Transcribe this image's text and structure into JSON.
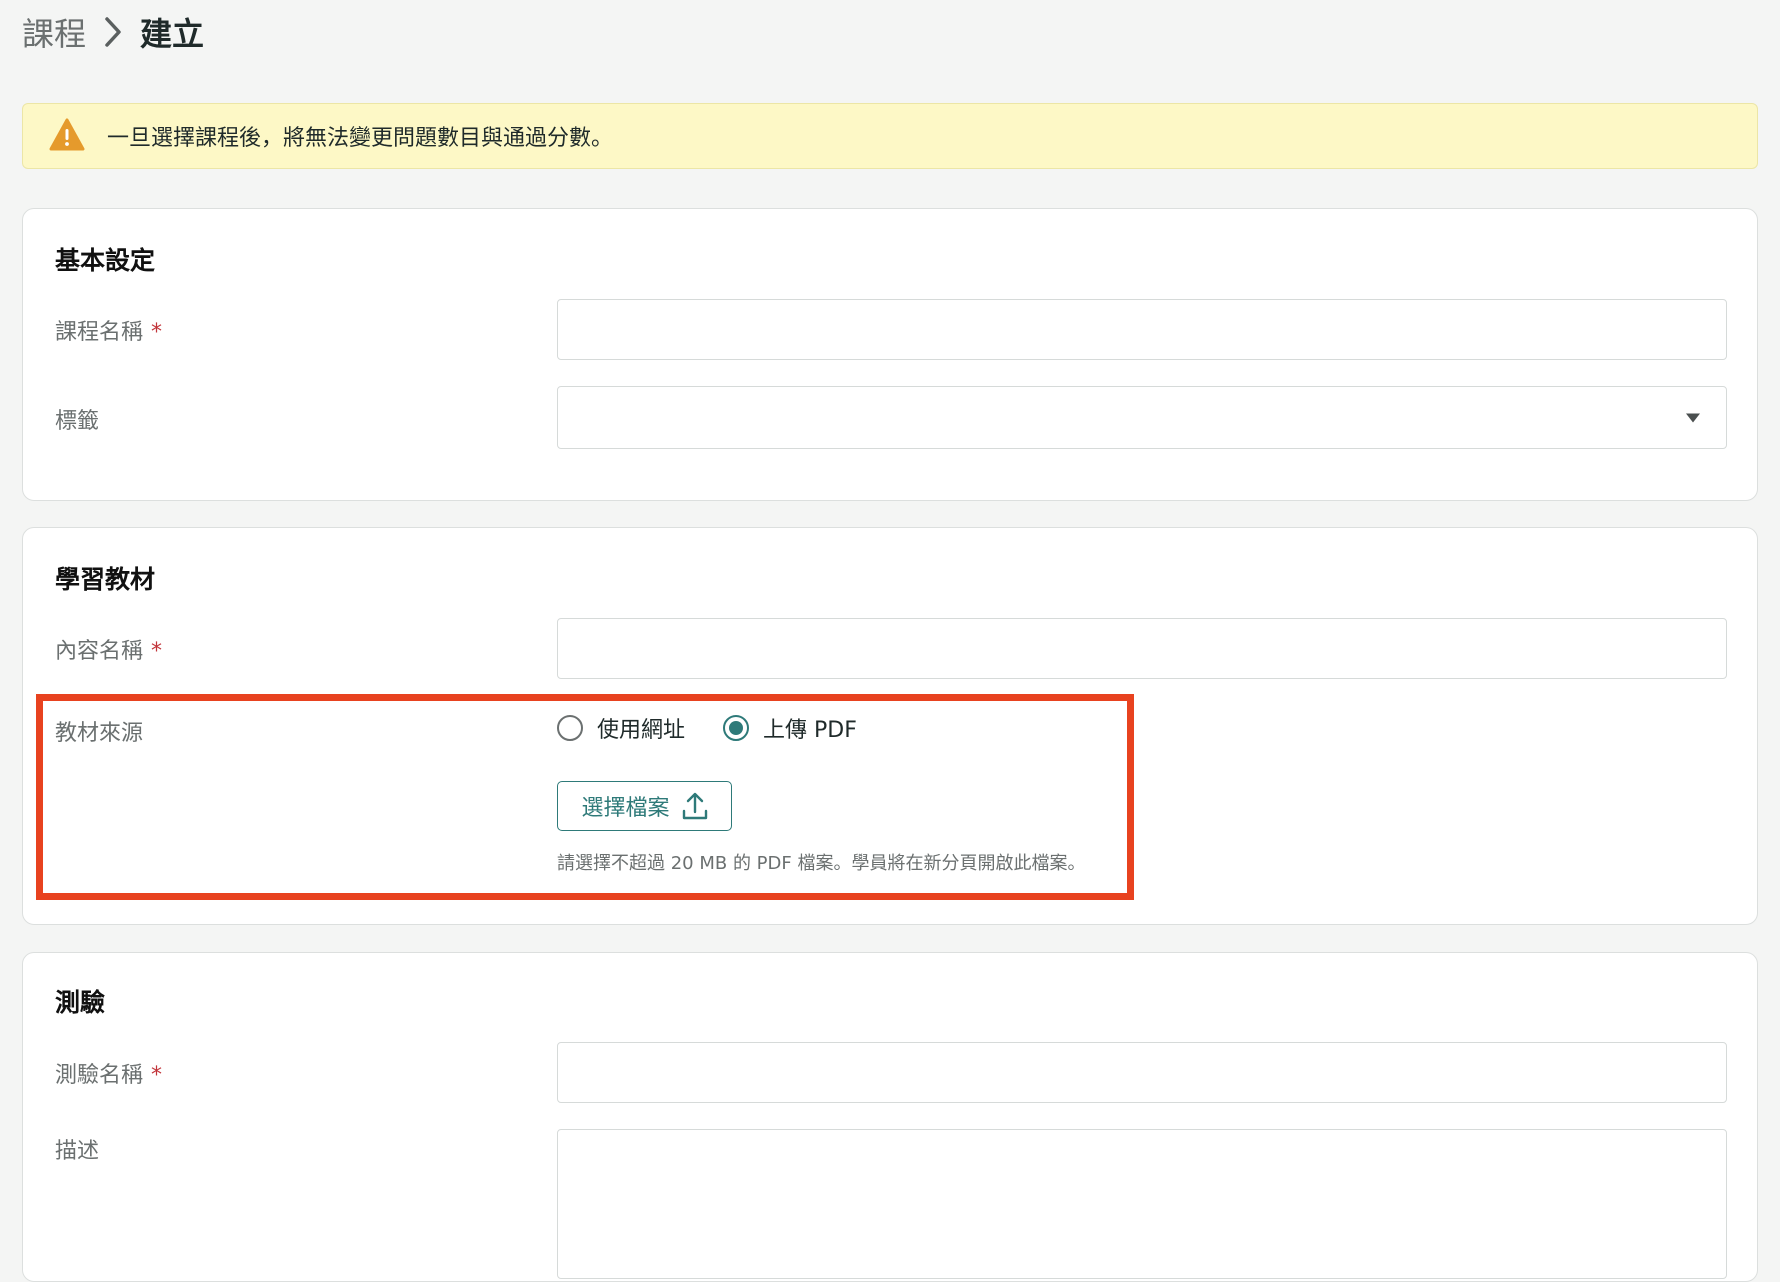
{
  "breadcrumb": {
    "parent": "課程",
    "current": "建立"
  },
  "warning": {
    "text": "一旦選擇課程後，將無法變更問題數目與通過分數。"
  },
  "basic": {
    "title": "基本設定",
    "course_name_label": "課程名稱",
    "course_name_value": "",
    "tags_label": "標籤",
    "tags_value": ""
  },
  "material": {
    "title": "學習教材",
    "content_name_label": "內容名稱",
    "content_name_value": "",
    "source_label": "教材來源",
    "source_options": [
      "使用網址",
      "上傳 PDF"
    ],
    "source_selected": "上傳 PDF",
    "upload_button": "選擇檔案",
    "hint": "請選擇不超過 20 MB 的 PDF 檔案。學員將在新分頁開啟此檔案。"
  },
  "quiz": {
    "title": "測驗",
    "quiz_name_label": "測驗名稱",
    "quiz_name_value": "",
    "description_label": "描述",
    "description_value": ""
  },
  "required_marker": "*",
  "colors": {
    "accent": "#2e7a79",
    "required": "#c2343a",
    "warning_bg": "#fdf8c6",
    "warning_icon": "#e59a2c",
    "highlight": "#e8421f"
  }
}
